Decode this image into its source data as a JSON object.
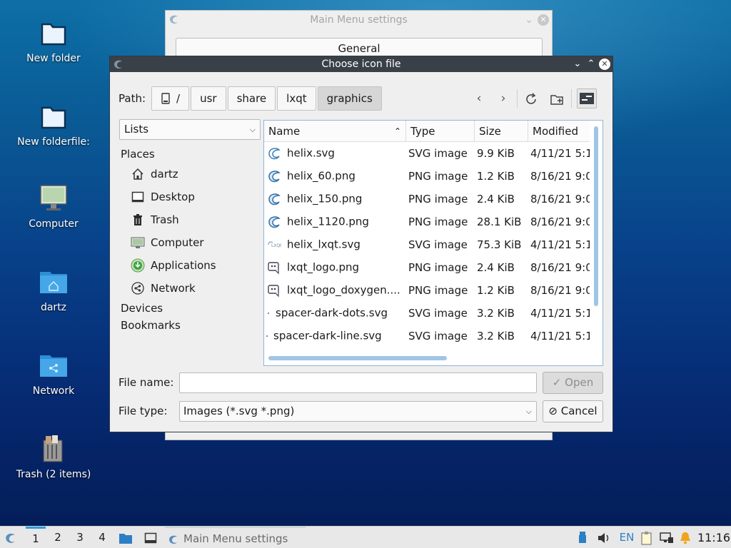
{
  "desktop": {
    "icons": [
      {
        "label": "New folder",
        "icon": "folder-icon"
      },
      {
        "label": "New folderfile:",
        "icon": "folder-icon"
      },
      {
        "label": "Computer",
        "icon": "computer-icon"
      },
      {
        "label": "dartz",
        "icon": "home-folder-icon"
      },
      {
        "label": "Network",
        "icon": "network-folder-icon"
      },
      {
        "label": "Trash (2 items)",
        "icon": "trash-icon"
      }
    ]
  },
  "background_window": {
    "title": "Main Menu settings",
    "tab": "General"
  },
  "dialog": {
    "title": "Choose icon file",
    "path_label": "Path:",
    "breadcrumbs": [
      "/",
      "usr",
      "share",
      "lxqt",
      "graphics"
    ],
    "view_selector": "Lists",
    "places_header": "Places",
    "places": [
      {
        "label": "dartz",
        "icon": "home-icon"
      },
      {
        "label": "Desktop",
        "icon": "desktop-icon"
      },
      {
        "label": "Trash",
        "icon": "trash-icon"
      },
      {
        "label": "Computer",
        "icon": "computer-icon"
      },
      {
        "label": "Applications",
        "icon": "applications-icon"
      },
      {
        "label": "Network",
        "icon": "network-icon"
      }
    ],
    "devices_header": "Devices",
    "bookmarks_header": "Bookmarks",
    "columns": [
      "Name",
      "Type",
      "Size",
      "Modified"
    ],
    "files": [
      {
        "name": "helix.svg",
        "type": "SVG image",
        "size": "9.9 KiB",
        "modified": "4/11/21 5:1",
        "icon": "helix-icon"
      },
      {
        "name": "helix_60.png",
        "type": "PNG image",
        "size": "1.2 KiB",
        "modified": "8/16/21 9:0",
        "icon": "helix-icon"
      },
      {
        "name": "helix_150.png",
        "type": "PNG image",
        "size": "2.4 KiB",
        "modified": "8/16/21 9:0",
        "icon": "helix-icon"
      },
      {
        "name": "helix_1120.png",
        "type": "PNG image",
        "size": "28.1 KiB",
        "modified": "8/16/21 9:0",
        "icon": "helix-icon"
      },
      {
        "name": "helix_lxqt.svg",
        "type": "SVG image",
        "size": "75.3 KiB",
        "modified": "4/11/21 5:1",
        "icon": "lxqt-text-icon"
      },
      {
        "name": "lxqt_logo.png",
        "type": "PNG image",
        "size": "2.4 KiB",
        "modified": "8/16/21 9:0",
        "icon": "lxqt-logo-icon"
      },
      {
        "name": "lxqt_logo_doxygen....",
        "type": "PNG image",
        "size": "1.2 KiB",
        "modified": "8/16/21 9:0",
        "icon": "lxqt-logo-icon"
      },
      {
        "name": "spacer-dark-dots.svg",
        "type": "SVG image",
        "size": "3.2 KiB",
        "modified": "4/11/21 5:1",
        "icon": "dot-icon"
      },
      {
        "name": "spacer-dark-line.svg",
        "type": "SVG image",
        "size": "3.2 KiB",
        "modified": "4/11/21 5:1",
        "icon": "dot-icon"
      }
    ],
    "file_name_label": "File name:",
    "file_name_value": "",
    "file_type_label": "File type:",
    "file_type_value": "Images (*.svg *.png)",
    "open_label": "Open",
    "cancel_label": "Cancel"
  },
  "taskbar": {
    "workspaces": [
      "1",
      "2",
      "3",
      "4"
    ],
    "active_workspace": "1",
    "task_title": "Main Menu settings",
    "keyboard_layout": "EN",
    "clock": "11:16"
  },
  "colors": {
    "accent": "#2f9fe0",
    "titlebar": "#3a4048",
    "selection_border": "#8fb7d9"
  }
}
